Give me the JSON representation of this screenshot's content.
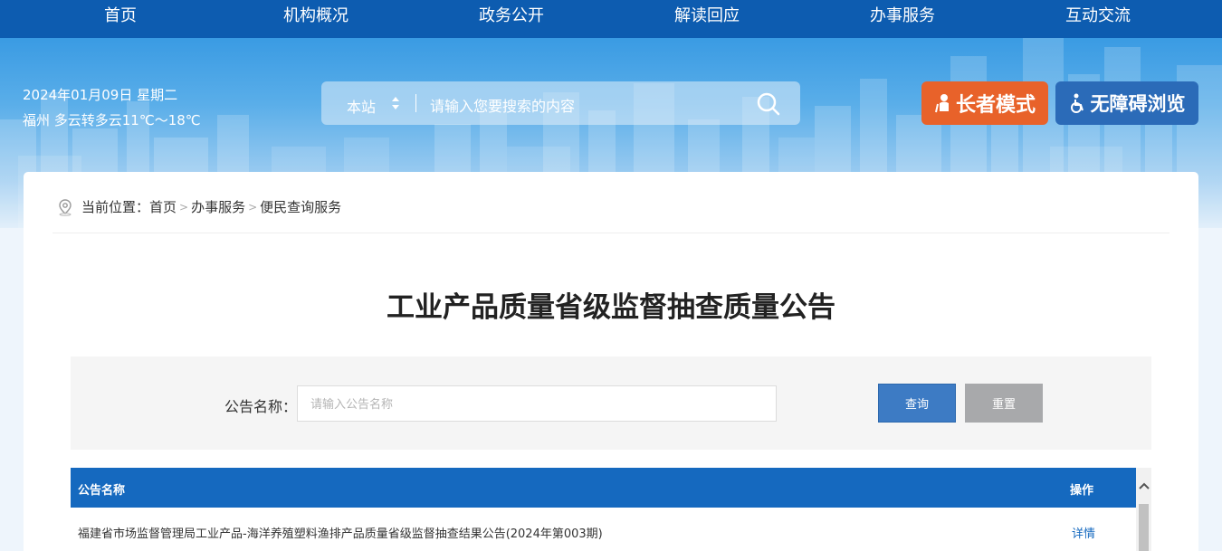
{
  "nav": {
    "items": [
      {
        "label": "首页"
      },
      {
        "label": "机构概况"
      },
      {
        "label": "政务公开"
      },
      {
        "label": "解读回应"
      },
      {
        "label": "办事服务"
      },
      {
        "label": "互动交流"
      }
    ]
  },
  "header": {
    "date": "2024年01月09日 星期二",
    "weather": "福州 多云转多云11℃～18℃",
    "search": {
      "scope": "本站",
      "placeholder": "请输入您要搜索的内容",
      "icon": "search-icon"
    },
    "elder_mode_label": "长者模式",
    "accessible_label": "无障碍浏览"
  },
  "breadcrumb": {
    "prefix": "当前位置：",
    "items": [
      "首页",
      "办事服务",
      "便民查询服务"
    ],
    "separator": ">"
  },
  "page": {
    "title": "工业产品质量省级监督抽查质量公告"
  },
  "filter": {
    "label": "公告名称：",
    "placeholder": "请输入公告名称",
    "query_label": "查询",
    "reset_label": "重置"
  },
  "table": {
    "columns": [
      "公告名称",
      "操作"
    ],
    "rows": [
      {
        "name": "福建省市场监督管理局工业产品-海洋养殖塑料渔排产品质量省级监督抽查结果公告(2024年第003期)",
        "action": "详情"
      }
    ]
  },
  "colors": {
    "nav_bg": "#0d5cb0",
    "elder_btn": "#e8622a",
    "access_btn": "#2b6bb8",
    "table_header": "#1569bf",
    "query_btn": "#3d7bc4",
    "reset_btn": "#a8a9ab"
  }
}
